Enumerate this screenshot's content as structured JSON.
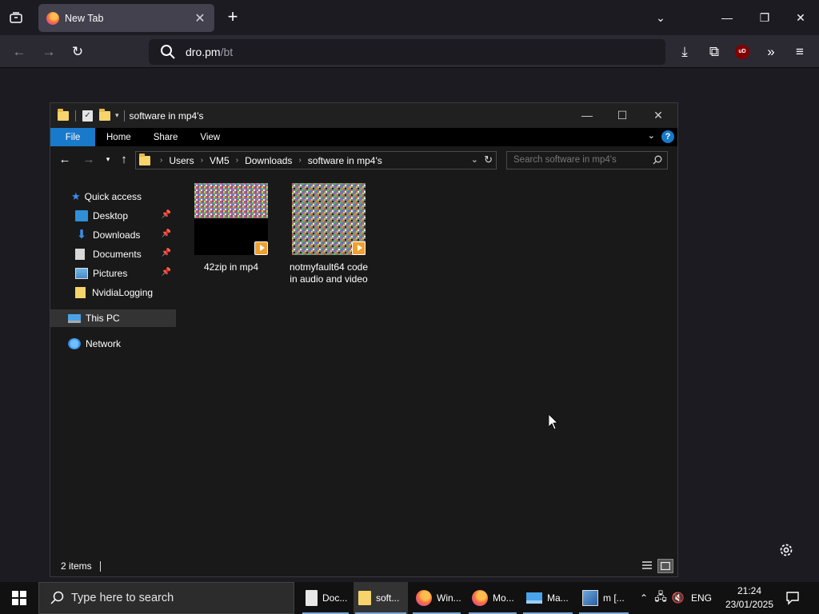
{
  "browser": {
    "tab_title": "New Tab",
    "url_host": "dro.pm",
    "url_path": "/bt",
    "ublock_badge": "uD"
  },
  "explorer": {
    "window_title": "software in mp4's",
    "ribbon": {
      "file": "File",
      "home": "Home",
      "share": "Share",
      "view": "View",
      "help": "?"
    },
    "breadcrumbs": [
      "Users",
      "VM5",
      "Downloads",
      "software in mp4's"
    ],
    "search_placeholder": "Search software in mp4's",
    "nav": {
      "quick_access": "Quick access",
      "desktop": "Desktop",
      "downloads": "Downloads",
      "documents": "Documents",
      "pictures": "Pictures",
      "nvidia": "NvidiaLogging",
      "this_pc": "This PC",
      "network": "Network"
    },
    "files": [
      {
        "name": "42zip in mp4"
      },
      {
        "name": "notmyfault64 code in audio and video"
      }
    ],
    "status": "2 items"
  },
  "taskbar": {
    "search_placeholder": "Type here to search",
    "apps": [
      {
        "label": "Doc..."
      },
      {
        "label": "soft..."
      },
      {
        "label": "Win..."
      },
      {
        "label": "Mo..."
      },
      {
        "label": "Ma..."
      },
      {
        "label": "m [..."
      }
    ],
    "lang": "ENG",
    "time": "21:24",
    "date": "23/01/2025"
  },
  "colors": {
    "accent": "#1979ca",
    "browser_bg": "#1c1b22",
    "explorer_bg": "#191919"
  }
}
